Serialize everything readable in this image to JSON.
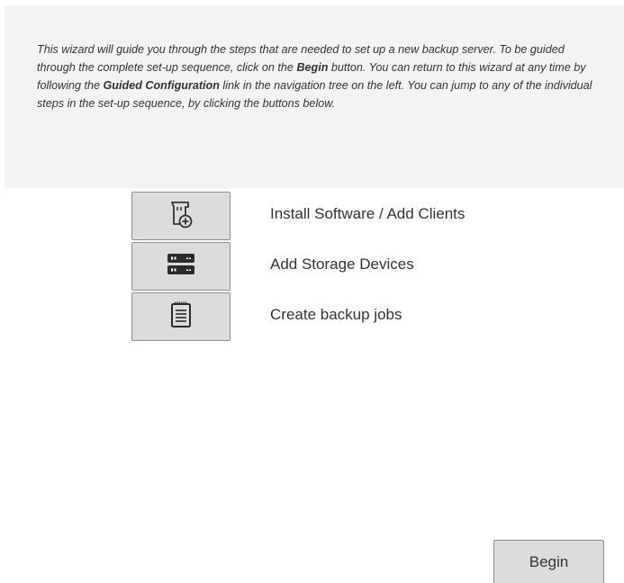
{
  "intro": {
    "part1": "This wizard will guide you through the steps that are needed to set up a new backup server. To be guided through the complete set-up sequence, click on the ",
    "bold1": "Begin",
    "part2": " button. You can return to this wizard at any time by following the ",
    "bold2": "Guided Configuration",
    "part3": " link in the navigation tree on the left. You can jump to any of the individual steps in the set-up sequence, by clicking the buttons below."
  },
  "steps": [
    {
      "label": "Install Software / Add Clients",
      "icon": "install-software-icon"
    },
    {
      "label": "Add Storage Devices",
      "icon": "storage-devices-icon"
    },
    {
      "label": "Create backup jobs",
      "icon": "backup-jobs-icon"
    }
  ],
  "actions": {
    "begin_label": "Begin"
  }
}
